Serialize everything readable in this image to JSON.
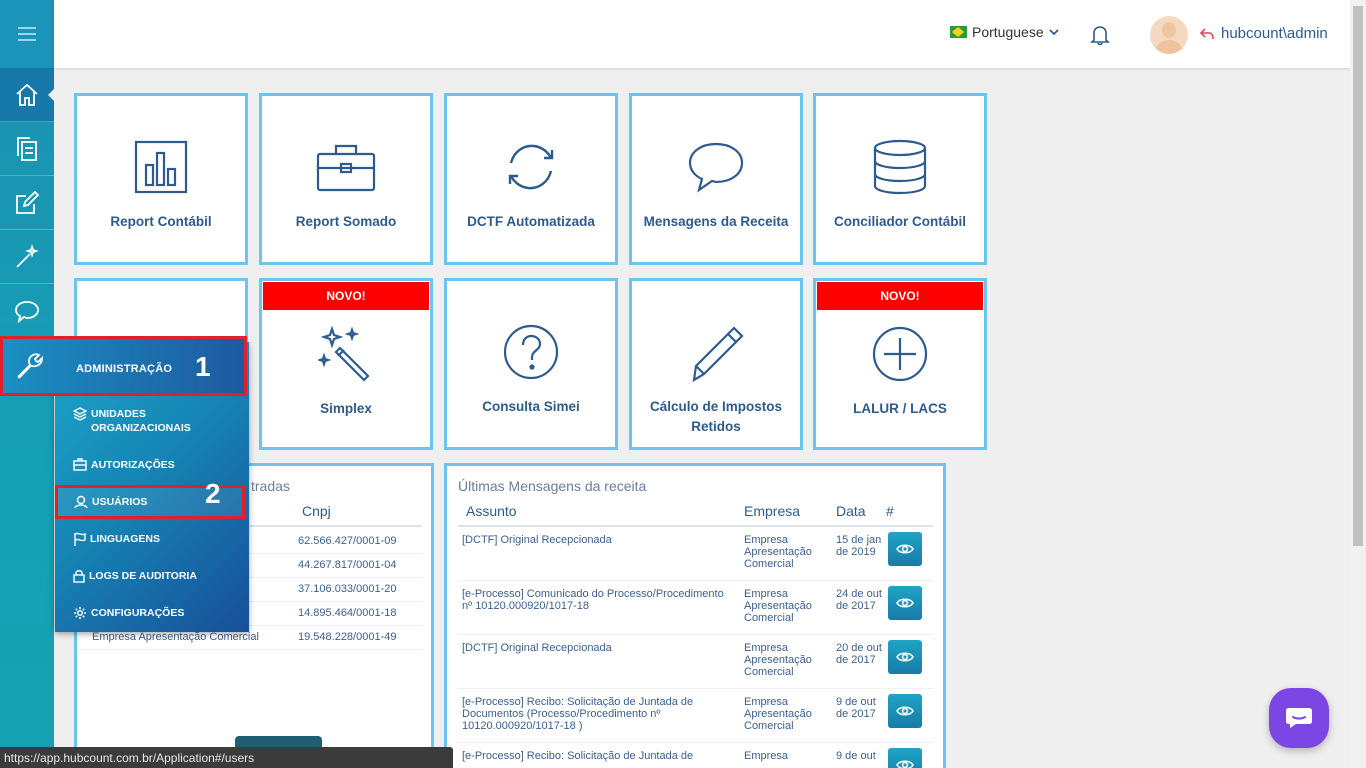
{
  "header": {
    "language": "Portuguese",
    "user": "hubcount\\admin"
  },
  "tiles": [
    {
      "label": "Report Contábil",
      "icon": "bar-chart-icon"
    },
    {
      "label": "Report Somado",
      "icon": "briefcase-icon"
    },
    {
      "label": "DCTF Automatizada",
      "icon": "refresh-icon"
    },
    {
      "label": "Mensagens da Receita",
      "icon": "chat-bubble-icon"
    },
    {
      "label": "Conciliador Contábil",
      "icon": "database-icon"
    },
    {
      "label": "Simplex",
      "icon": "magic-wand-icon",
      "badge": "NOVO!"
    },
    {
      "label": "Consulta Simei",
      "icon": "question-circle-icon"
    },
    {
      "label": "Cálculo de Impostos Retidos",
      "icon": "pencil-icon"
    },
    {
      "label": "LALUR / LACS",
      "icon": "plus-circle-icon",
      "badge": "NOVO!"
    }
  ],
  "companies_panel": {
    "title_partial": "tradas",
    "col_cnpj": "Cnpj",
    "rows": [
      {
        "name": "",
        "cnpj": "62.566.427/0001-09"
      },
      {
        "name": "",
        "cnpj": "44.267.817/0001-04"
      },
      {
        "name": "",
        "cnpj": "37.106.033/0001-20"
      },
      {
        "name": "",
        "cnpj": "14.895.464/0001-18"
      },
      {
        "name": "Empresa Apresentação Comercial",
        "cnpj": "19.548.228/0001-49"
      }
    ]
  },
  "messages_panel": {
    "title": "Últimas Mensagens da receita",
    "columns": {
      "subject": "Assunto",
      "company": "Empresa",
      "date": "Data",
      "action": "#"
    },
    "rows": [
      {
        "subject": "[DCTF] Original Recepcionada",
        "company": "Empresa Apresentação Comercial",
        "date": "15 de jan de 2019"
      },
      {
        "subject": "[e-Processo] Comunicado do Processo/Procedimento nº 10120.000920/1017-18",
        "company": "Empresa Apresentação Comercial",
        "date": "24 de out de 2017"
      },
      {
        "subject": "[DCTF] Original Recepcionada",
        "company": "Empresa Apresentação Comercial",
        "date": "20 de out de 2017"
      },
      {
        "subject": "[e-Processo] Recibo: Solicitação de Juntada de Documentos (Processo/Procedimento nº 10120.000920/1017-18 )",
        "company": "Empresa Apresentação Comercial",
        "date": "9 de out de 2017"
      },
      {
        "subject": "[e-Processo] Recibo: Solicitação de Juntada de",
        "company": "Empresa",
        "date": "9 de out"
      }
    ]
  },
  "admin_menu": {
    "title": "ADMINISTRAÇÃO",
    "step1": "1",
    "step2": "2",
    "items": [
      {
        "label": "UNIDADES ORGANIZACIONAIS",
        "icon": "layers-icon"
      },
      {
        "label": "AUTORIZAÇÕES",
        "icon": "briefcase-icon"
      },
      {
        "label": "USUÁRIOS",
        "icon": "user-icon"
      },
      {
        "label": "LINGUAGENS",
        "icon": "flag-icon"
      },
      {
        "label": "LOGS DE AUDITORIA",
        "icon": "lock-icon"
      },
      {
        "label": "CONFIGURAÇÕES",
        "icon": "gear-icon"
      }
    ]
  },
  "status_url": "https://app.hubcount.com.br/Application#/users",
  "colors": {
    "tile_border": "#6ac6ee",
    "badge": "#ff0000",
    "highlight": "#e0202a",
    "chat": "#7b46e3"
  }
}
